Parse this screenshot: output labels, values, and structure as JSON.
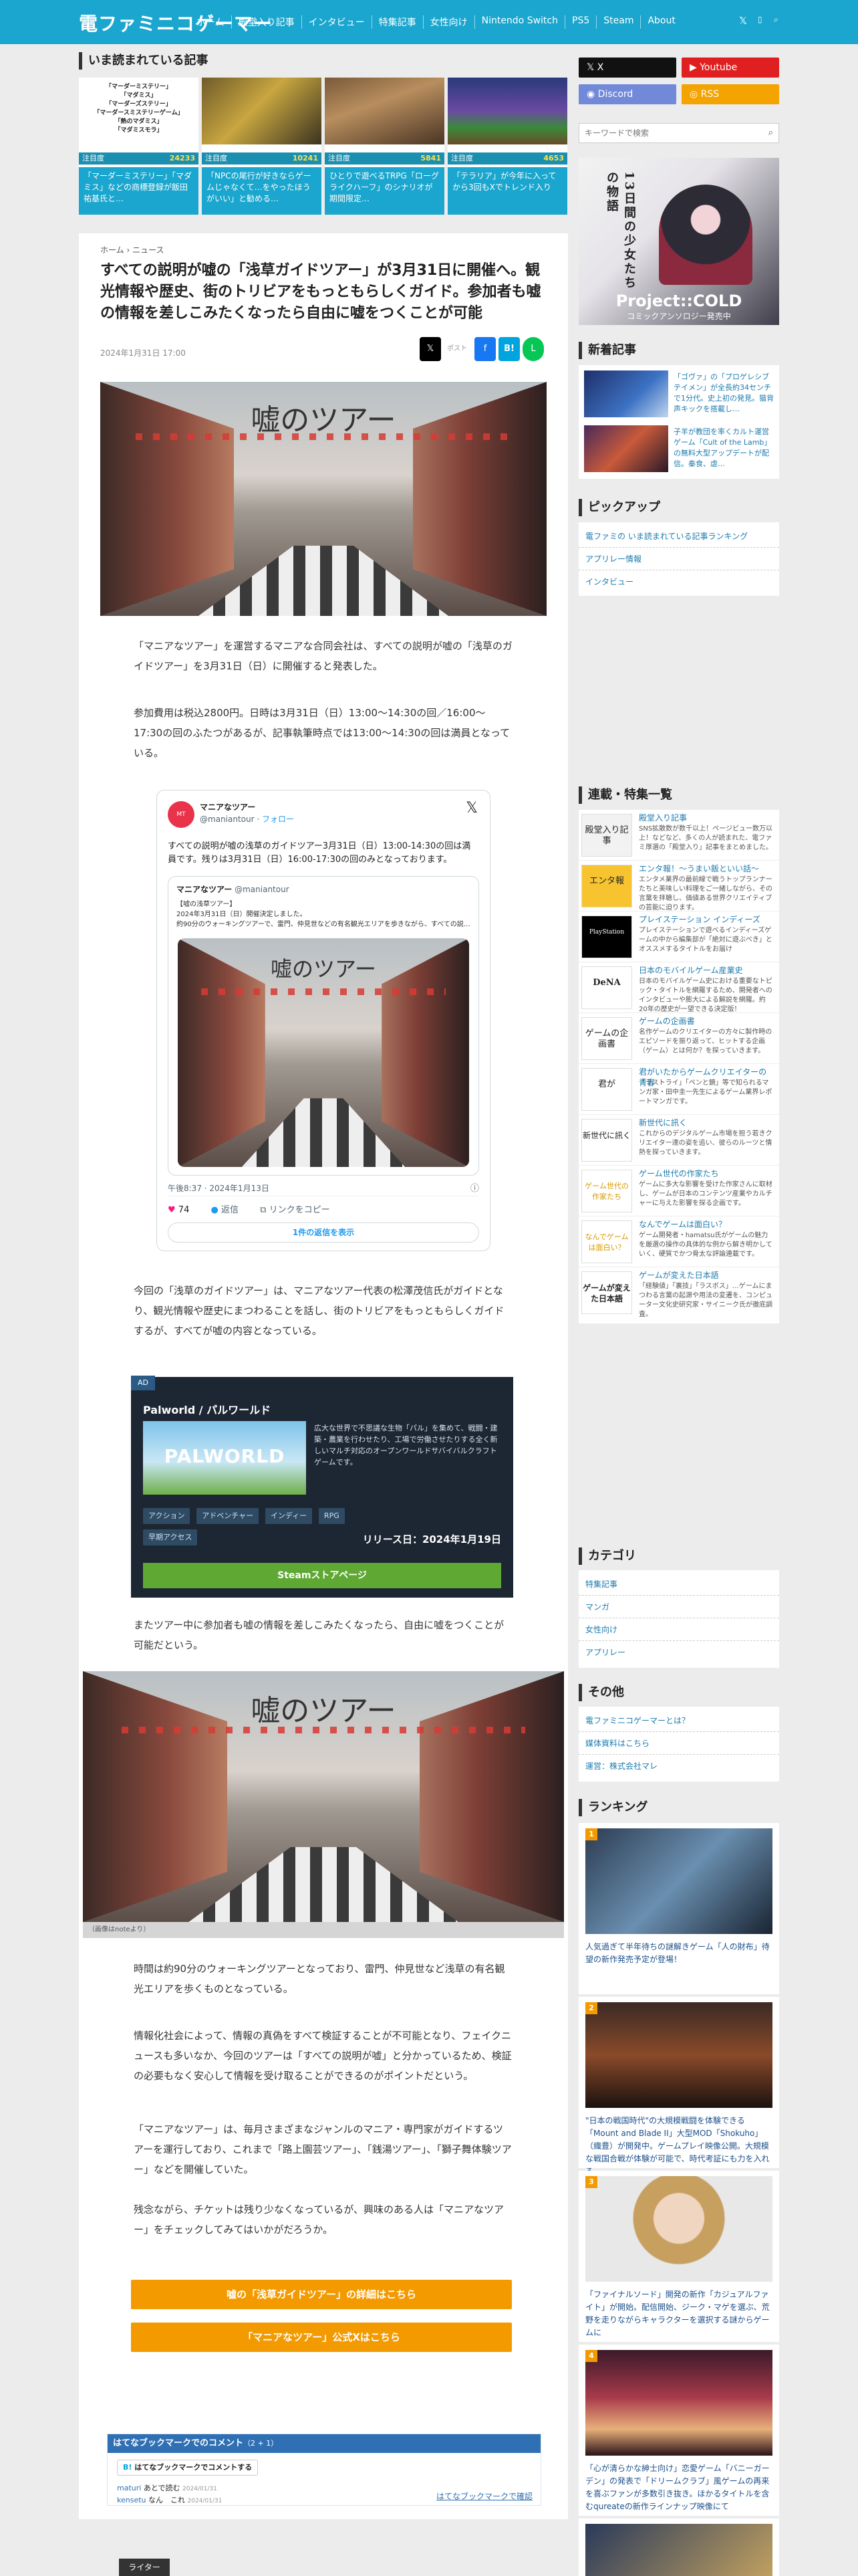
{
  "header": {
    "logo": "電ファミニコゲーマー",
    "nav": [
      "ホーム",
      "殿堂入り記事",
      "インタビュー",
      "特集記事",
      "女性向け",
      "Nintendo Switch",
      "PS5",
      "Steam",
      "About"
    ]
  },
  "trending": {
    "heading": "いま読まれている記事",
    "items": [
      {
        "cat": "注目度",
        "count": "24233",
        "title": "「マーダーミステリー」「マダミス」などの商標登録が飯田祐基氏と…",
        "label_1": "「マーダーミステリー」",
        "label_2": "「マダミス」",
        "label_3": "「マーダーズステリー」",
        "label_4": "「マーダースミステリーゲーム」",
        "label_5": "「熱のマダミス」",
        "label_6": "「マダミスモラ」"
      },
      {
        "cat": "注目度",
        "count": "10241",
        "title": "「NPCの尾行が好きならゲームじゃなくて…をやったほうがいい」と勧める…"
      },
      {
        "cat": "注目度",
        "count": "5841",
        "title": "ひとりで遊べるTRPG「ローグライクハーフ」のシナリオが期間限定…"
      },
      {
        "cat": "注目度",
        "count": "4653",
        "title": "「テラリア」が今年に入ってから3回もXでトレンド入り"
      }
    ]
  },
  "social": {
    "x": "X",
    "youtube": "Youtube",
    "discord": "Discord",
    "rss": "RSS"
  },
  "search": {
    "placeholder": "キーワードで検索"
  },
  "ad_banner": {
    "tag": "13日間の少女たちの物語",
    "title": "Project::COLD",
    "sub": "コミックアンソロジー発売中"
  },
  "article": {
    "breadcrumb": "ホーム › ニュース",
    "title": "すべての説明が嘘の「浅草ガイドツアー」が3月31日に開催へ。観光情報や歴史、街のトリビアをもっともらしくガイド。参加者も嘘の情報を差しこみたくなったら自由に嘘をつくことが可能",
    "date": "2024年1月31日 17:00",
    "share": {
      "x": "𝕏",
      "post": "ポスト",
      "fb": "f",
      "hatena": "B!",
      "line": "L"
    },
    "hero_caption": "嘘のツアー",
    "p1": "「マニアなツアー」を運営するマニアな合同会社は、すべての説明が嘘の「浅草のガイドツアー」を3月31日（日）に開催すると発表した。",
    "p2": "参加費用は税込2800円。日時は3月31日（日）13:00〜14:30の回／16:00〜17:30の回のふたつがあるが、記事執筆時点では13:00〜14:30の回は満員となっている。",
    "p3": "今回の「浅草のガイドツアー」は、マニアなツアー代表の松澤茂信氏がガイドとなり、観光情報や歴史にまつわることを話し、街のトリビアをもっともらしくガイドするが、すべてが嘘の内容となっている。",
    "p4": "またツアー中に参加者も嘘の情報を差しこみたくなったら、自由に嘘をつくことが可能だという。",
    "img2_credit": "（画像はnoteより）",
    "p5": "時間は約90分のウォーキングツアーとなっており、雷門、仲見世など浅草の有名観光エリアを歩くものとなっている。",
    "p6": "情報化社会によって、情報の真偽をすべて検証することが不可能となり、フェイクニュースも多いなか、今回のツアーは「すべての説明が嘘」と分かっているため、検証の必要もなく安心して情報を受け取ることができるのがポイントだという。",
    "p7": "「マニアなツアー」は、毎月さまざまなジャンルのマニア・専門家がガイドするツアーを運行しており、これまで「路上園芸ツアー」、「銭湯ツアー」、「獅子舞体験ツアー」などを開催していた。",
    "p8": "残念ながら、チケットは残り少なくなっているが、興味のある人は「マニアなツアー」をチェックしてみてはいかがだろうか。",
    "btn1": "嘘の「浅草ガイドツアー」の詳細はこちら",
    "btn2": "「マニアなツアー」公式Xはこちら",
    "writer": "ライター"
  },
  "tweet": {
    "name": "マニアなツアー",
    "handle": "@maniantour",
    "follow": "フォロー",
    "body": "すべての説明が嘘の浅草のガイドツアー3月31日（日）13:00-14:30の回は満員です。残りは3月31日（日）16:00-17:30の回のみとなっております。",
    "quote_name": "マニアなツアー",
    "quote_handle": "@maniantour",
    "quote_l1": "【嘘の浅草ツアー】",
    "quote_l2": "2024年3月31日（日）開催決定しました。",
    "quote_l3": "約90分のウォーキングツアーで、雷門、仲見世などの有名観光エリアを歩きながら、すべての説明が嘘のガイドをします。",
    "quote_caption": "嘘のツアー",
    "time": "午後8:37 · 2024年1月13日",
    "likes": "74",
    "reply": "返信",
    "copy": "リンクをコピー",
    "more": "1件の返信を表示"
  },
  "promo": {
    "ad": "AD",
    "game": "Palworld / パルワールド",
    "logo": "PALWORLD",
    "desc": "広大な世界で不思議な生物「パル」を集めて、戦闘・建築・農業を行わせたり、工場で労働させたりする全く新しいマルチ対応のオープンワールドサバイバルクラフトゲームです。",
    "tags": [
      "アクション",
      "アドベンチャー",
      "インディー",
      "RPG",
      "早期アクセス"
    ],
    "release": "リリース日：2024年1月19日",
    "cta": "Steamストアページ"
  },
  "hatena": {
    "heading": "はてなブックマークでのコメント",
    "count": "（2 + 1）",
    "comment_btn": "はてなブックマークでコメントする",
    "c1_user": "maturi",
    "c1_text": "あとで読む",
    "c1_date": "2024/01/31",
    "c2_user": "kensetu",
    "c2_text": "なん　これ",
    "c2_date": "2024/01/31",
    "confirm": "はてなブックマークで確認"
  },
  "sidebar": {
    "new_heading": "新着記事",
    "new": [
      {
        "title": "「ゴヴァ」の「プロゲレシブテイメン」が全長約34センチで1分代。史上初の発見。猫背声キックを搭載し…"
      },
      {
        "title": "子羊が教団を率くカルト運営ゲーム「Cult of the Lamb」の無料大型アップデートが配信。秦食、虐…"
      }
    ],
    "pickup_heading": "ピックアップ",
    "pickup": [
      "電ファミの いま読まれている記事ランキング",
      "アプリレー情報",
      "インタビュー"
    ],
    "series_heading": "連載・特集一覧",
    "series": [
      {
        "icon": "殿堂入り記事",
        "title": "殿堂入り記事",
        "desc": "SNS拡散数が数千以上！ページビュー数万以上！などなど、多くの人が読まれた、電ファミ厚選の「殿堂入り」記事をまとめました。"
      },
      {
        "icon": "エンタ報",
        "title": "エンタ報！〜うまい飯といい話〜",
        "desc": "エンタメ業界の最前線で戦うトップランナーたちと美味しい料理をご一緒しながら、その言葉を拝聴し、価値ある世界クリエイティブの芸能に迫ります。"
      },
      {
        "icon": "PlayStation",
        "title": "プレイステーション インディーズ",
        "desc": "プレイステーションで遊べるインディーズゲームの中から編集部が「絶対に遊ぶべき」とオススメするタイトルをお届け"
      },
      {
        "icon": "DeNA",
        "title": "日本のモバイルゲーム産業史",
        "desc": "日本のモバイルゲーム史における重要なトピック・タイトルを網羅するため、開発者へのインタビューや膨大による解説を網羅。約20年の歴史が一望できる決定版！"
      },
      {
        "icon": "ゲームの企画書",
        "title": "ゲームの企画書",
        "desc": "名作ゲームのクリエイターの方々に製作時のエピソードを振り返って、ヒットする企画（ゲーム）とは何か？を探っていきます。"
      },
      {
        "icon": "君が",
        "title": "君がいたからゲームクリエイターの青春",
        "desc": "「ラストライ」「ペンと鏡」等で知られるマンガ家・田中圭一先生によるゲーム業界レポートマンガです。"
      },
      {
        "icon": "新世代に訊く",
        "title": "新世代に訊く",
        "desc": "これからのデジタルゲーム市場を担う若きクリエイター達の姿を追い、彼らのルーツと情熱を探っていきます。"
      },
      {
        "icon": "ゲーム世代の作家たち",
        "title": "ゲーム世代の作家たち",
        "desc": "ゲームに多大な影響を受けた作家さんに取材し、ゲームが日本のコンテンツ産業やカルチャーに与えた影響を探る企画です。"
      },
      {
        "icon": "なんでゲームは面白い？",
        "title": "なんでゲームは面白い？",
        "desc": "ゲーム開発者・hamatsu氏がゲームの魅力を厳選の操作の具体的な例から解き明かしていく、硬質でかつ骨太な評論連載です。"
      },
      {
        "icon": "ゲームが変えた日本語",
        "title": "ゲームが変えた日本語",
        "desc": "「経験値」「裏技」「ラスボス」…ゲームにまつわる言葉の起源や用法の変遷を、コンピューター文化史研究家・サイニーク氏が徹底調査。"
      }
    ],
    "category_heading": "カテゴリ",
    "category": [
      "特集記事",
      "マンガ",
      "女性向け",
      "アプリレー"
    ],
    "other_heading": "その他",
    "other": [
      "電ファミニコゲーマーとは？",
      "媒体資料はこちら",
      "運営：株式会社マレ"
    ],
    "ranking_heading": "ランキング",
    "ranking": [
      {
        "n": "1",
        "title": "人気過ぎて半年待ちの謎解きゲーム「人の財布」待望の新作発売予定が登場！"
      },
      {
        "n": "2",
        "title": "\"日本の戦国時代\"の大規模戦闘を体験できる「Mount and Blade II」大型MOD「Shokuho」（織豊）が開発中。ゲームプレイ映像公開。大規模な戦国合戦が体験が可能で、時代考証にも力を入れる"
      },
      {
        "n": "3",
        "title": "「ファイナルソード」開発の新作「カジュアルファイト」が開始。配信開始、ジーク・マゲを選ぶ、荒野を走りながらキャラクターを選択する謎からゲームに"
      },
      {
        "n": "4",
        "title": "「心が清らかな紳士向け」恋愛ゲーム「バニーガーデン」の発表で「ドリームクラブ」風ゲームの再来を喜ぶファンが多数引き抜き。ほかるタイトルを含むqureateの新作ラインナップ映像にて"
      }
    ]
  }
}
